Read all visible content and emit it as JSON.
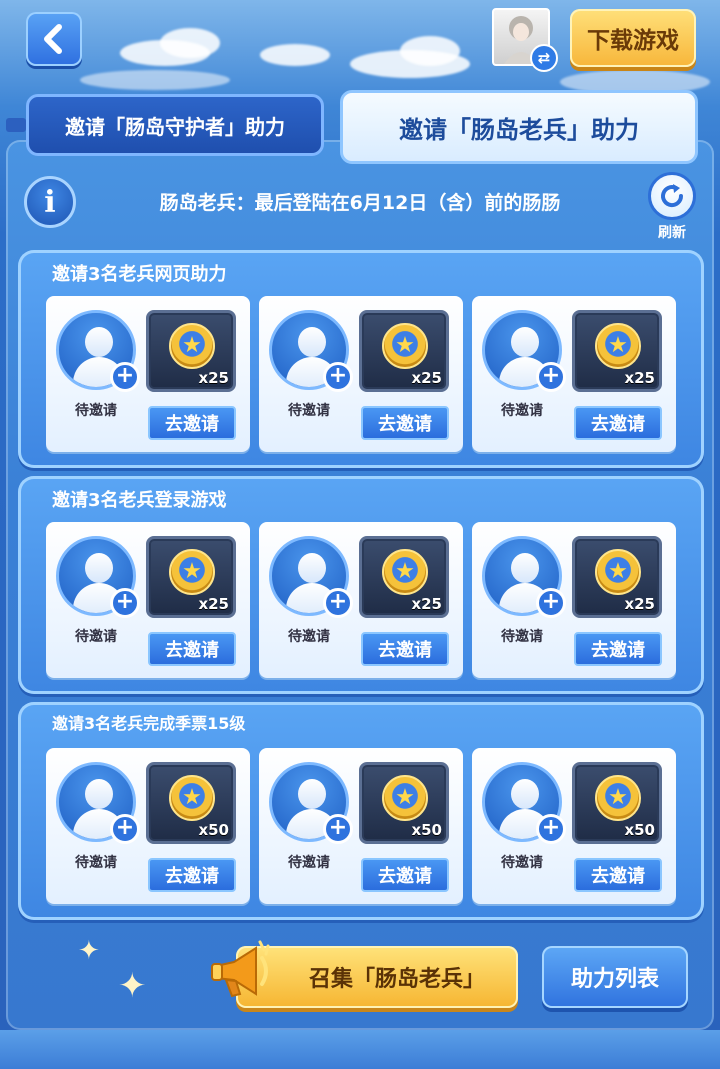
{
  "header": {
    "download_label": "下载游戏"
  },
  "tabs": [
    {
      "label": "邀请「肠岛守护者」助力",
      "active": false
    },
    {
      "label": "邀请「肠岛老兵」助力",
      "active": true
    }
  ],
  "info": {
    "text": "肠岛老兵：最后登陆在6月12日（含）前的肠肠",
    "refresh_label": "刷新"
  },
  "sections": [
    {
      "title": "邀请3名老兵网页助力",
      "slots": [
        {
          "status": "待邀请",
          "reward_qty": "x25",
          "button": "去邀请"
        },
        {
          "status": "待邀请",
          "reward_qty": "x25",
          "button": "去邀请"
        },
        {
          "status": "待邀请",
          "reward_qty": "x25",
          "button": "去邀请"
        }
      ]
    },
    {
      "title": "邀请3名老兵登录游戏",
      "slots": [
        {
          "status": "待邀请",
          "reward_qty": "x25",
          "button": "去邀请"
        },
        {
          "status": "待邀请",
          "reward_qty": "x25",
          "button": "去邀请"
        },
        {
          "status": "待邀请",
          "reward_qty": "x25",
          "button": "去邀请"
        }
      ]
    },
    {
      "title": "邀请3名老兵完成季票15级",
      "slots": [
        {
          "status": "待邀请",
          "reward_qty": "x50",
          "button": "去邀请"
        },
        {
          "status": "待邀请",
          "reward_qty": "x50",
          "button": "去邀请"
        },
        {
          "status": "待邀请",
          "reward_qty": "x50",
          "button": "去邀请"
        }
      ]
    }
  ],
  "footer": {
    "summon_label": "召集「肠岛老兵」",
    "list_label": "助力列表"
  },
  "icons": {
    "back": "chevron-left-icon",
    "swap": "swap-icon",
    "info": "info-icon",
    "refresh": "refresh-icon",
    "add_user": "user-plus-icon",
    "reward": "star-coin-icon",
    "megaphone": "megaphone-icon"
  }
}
